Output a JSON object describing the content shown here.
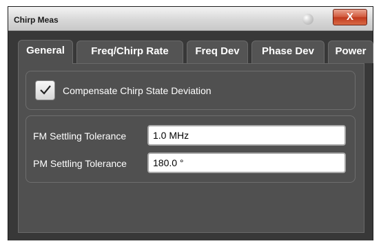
{
  "window": {
    "title": "Chirp Meas",
    "close_label": "X"
  },
  "tabs": [
    {
      "label": "General",
      "active": true
    },
    {
      "label": "Freq/Chirp Rate",
      "active": false
    },
    {
      "label": "Freq Dev",
      "active": false
    },
    {
      "label": "Phase Dev",
      "active": false
    },
    {
      "label": "Power",
      "active": false
    }
  ],
  "general": {
    "compensate_checkbox": {
      "label": "Compensate Chirp State Deviation",
      "checked": true
    },
    "fm_settling_tolerance": {
      "label": "FM Settling Tolerance",
      "value": "1.0 MHz"
    },
    "pm_settling_tolerance": {
      "label": "PM Settling Tolerance",
      "value": "180.0 °"
    }
  },
  "colors": {
    "background": "#383838",
    "panel": "#505050",
    "close_button": "#c0391d"
  }
}
